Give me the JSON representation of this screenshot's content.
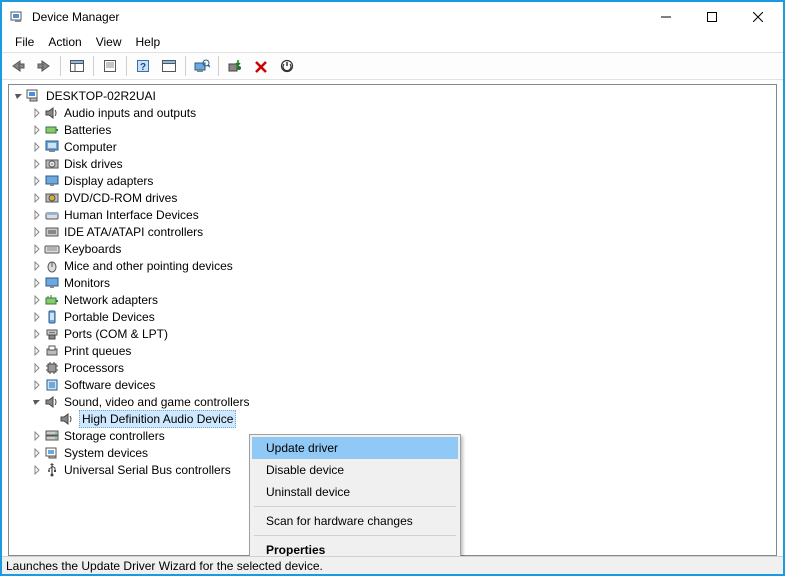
{
  "window": {
    "title": "Device Manager"
  },
  "menus": {
    "file": "File",
    "action": "Action",
    "view": "View",
    "help": "Help"
  },
  "root": {
    "name": "DESKTOP-02R2UAI"
  },
  "categories": [
    {
      "id": "audio",
      "label": "Audio inputs and outputs"
    },
    {
      "id": "batteries",
      "label": "Batteries"
    },
    {
      "id": "computer",
      "label": "Computer"
    },
    {
      "id": "disk",
      "label": "Disk drives"
    },
    {
      "id": "display",
      "label": "Display adapters"
    },
    {
      "id": "dvd",
      "label": "DVD/CD-ROM drives"
    },
    {
      "id": "hid",
      "label": "Human Interface Devices"
    },
    {
      "id": "ide",
      "label": "IDE ATA/ATAPI controllers"
    },
    {
      "id": "keyboards",
      "label": "Keyboards"
    },
    {
      "id": "mice",
      "label": "Mice and other pointing devices"
    },
    {
      "id": "monitors",
      "label": "Monitors"
    },
    {
      "id": "network",
      "label": "Network adapters"
    },
    {
      "id": "portable",
      "label": "Portable Devices"
    },
    {
      "id": "ports",
      "label": "Ports (COM & LPT)"
    },
    {
      "id": "printq",
      "label": "Print queues"
    },
    {
      "id": "processors",
      "label": "Processors"
    },
    {
      "id": "softdev",
      "label": "Software devices"
    },
    {
      "id": "sound",
      "label": "Sound, video and game controllers",
      "expanded": true,
      "children": [
        {
          "id": "hda",
          "label": "High Definition Audio Device",
          "selected": true
        }
      ]
    },
    {
      "id": "storage",
      "label": "Storage controllers"
    },
    {
      "id": "system",
      "label": "System devices"
    },
    {
      "id": "usb",
      "label": "Universal Serial Bus controllers"
    }
  ],
  "context_menu": {
    "update": "Update driver",
    "disable": "Disable device",
    "uninstall": "Uninstall device",
    "scan": "Scan for hardware changes",
    "properties": "Properties"
  },
  "status": "Launches the Update Driver Wizard for the selected device."
}
